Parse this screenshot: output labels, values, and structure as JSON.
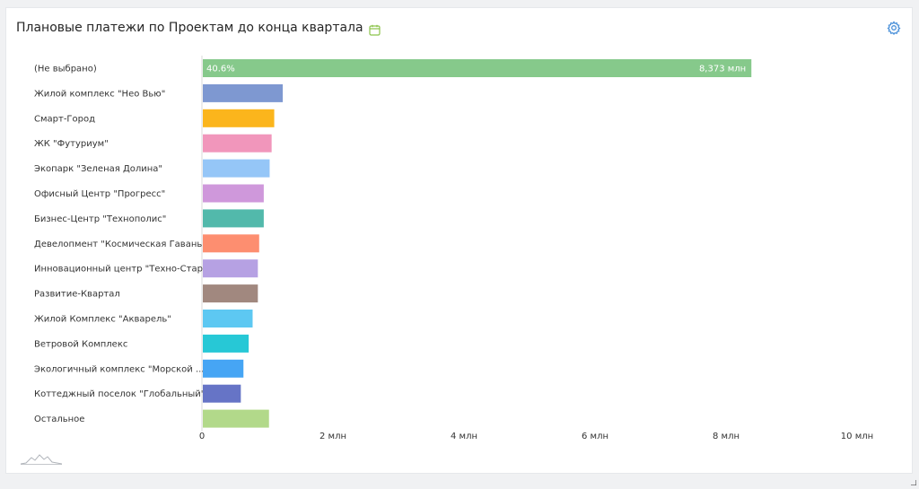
{
  "header": {
    "title": "Плановые платежи по Проектам до конца квартала",
    "title_icon": "calendar-icon",
    "settings_icon": "gear-icon"
  },
  "chart_data": {
    "type": "bar",
    "orientation": "horizontal",
    "title": "Плановые платежи по Проектам до конца квартала",
    "xlabel": "",
    "ylabel": "",
    "xlim": [
      0,
      10000000
    ],
    "x_ticks": [
      0,
      2000000,
      4000000,
      6000000,
      8000000,
      10000000
    ],
    "x_tick_labels": [
      "0",
      "2 млн",
      "4 млн",
      "6 млн",
      "8 млн",
      "10 млн"
    ],
    "grid": false,
    "categories": [
      "(Не выбрано)",
      "Жилой комплекс \"Нео Вью\"",
      "Смарт-Город",
      "ЖК \"Футуриум\"",
      "Экопарк \"Зеленая Долина\"",
      "Офисный Центр \"Прогресс\"",
      "Бизнес-Центр \"Технополис\"",
      "Девелопмент \"Космическая Гавань\"",
      "Инновационный центр \"Техно-Старт\"",
      "Развитие-Квартал",
      "Жилой Комплекс \"Акварель\"",
      "Ветровой Комплекс",
      "Экологичный комплекс \"Морской ...",
      "Коттеджный поселок \"Глобальный\"",
      "Остальное"
    ],
    "values": [
      8373000,
      1220000,
      1090000,
      1050000,
      1020000,
      930000,
      930000,
      860000,
      840000,
      840000,
      760000,
      700000,
      620000,
      580000,
      1010000
    ],
    "colors": [
      "#86c98b",
      "#7e98d1",
      "#fbb51c",
      "#f196bb",
      "#95c6f7",
      "#cf98db",
      "#52b9ab",
      "#fd8e70",
      "#b6a1e3",
      "#a1887f",
      "#5dc8f2",
      "#27c8d6",
      "#46a5f4",
      "#6674c6",
      "#b2d98a"
    ],
    "bar_annotations": [
      {
        "index": 0,
        "share": "40.6%",
        "value_text": "8,373 млн"
      }
    ]
  }
}
